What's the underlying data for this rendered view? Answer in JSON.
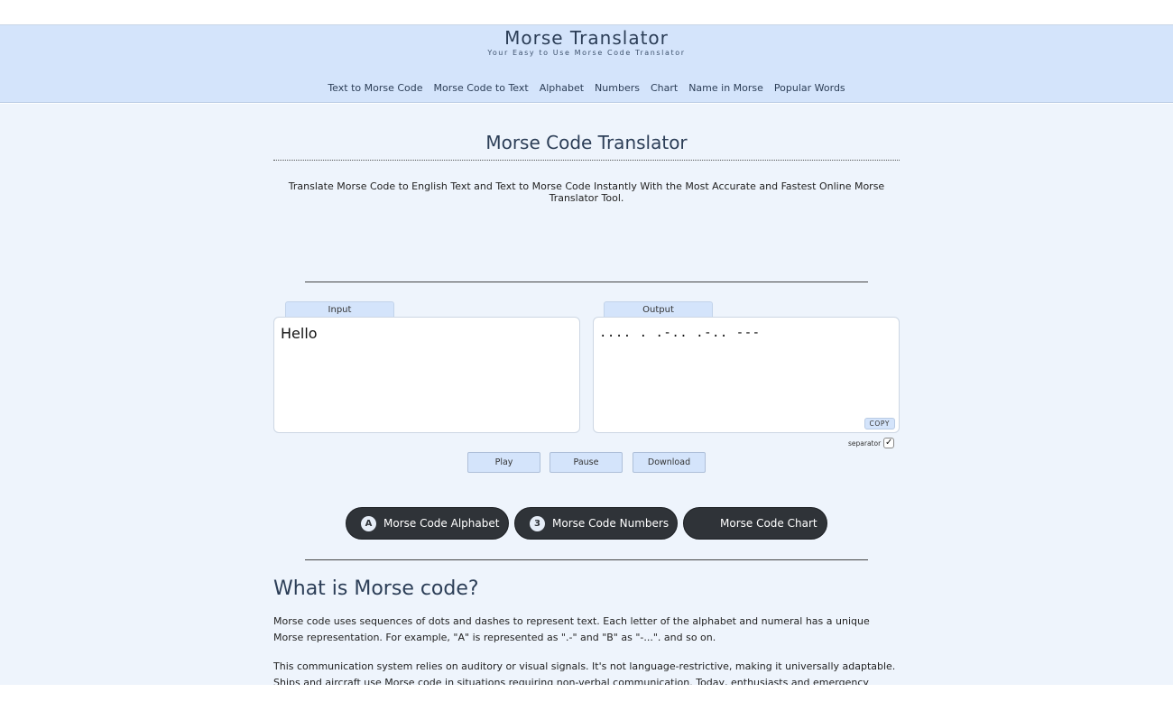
{
  "header": {
    "title": "Morse Translator",
    "subtitle": "Your Easy to Use Morse Code Translator",
    "nav": [
      "Text to Morse Code",
      "Morse Code to Text",
      "Alphabet",
      "Numbers",
      "Chart",
      "Name in Morse",
      "Popular Words"
    ]
  },
  "main": {
    "heading": "Morse Code Translator",
    "intro": "Translate Morse Code to English Text and Text to Morse Code Instantly With the Most Accurate and Fastest Online Morse Translator Tool.",
    "input_tab": "Input",
    "input_value": "Hello",
    "output_tab": "Output",
    "output_value": ".... . .-.. .-.. ---",
    "copy_label": "COPY",
    "separator_label": "separator",
    "separator_checked": true,
    "controls": [
      "Play",
      "Pause",
      "Download"
    ],
    "links": [
      {
        "badge": "A",
        "label": "Morse Code Alphabet"
      },
      {
        "badge": "3",
        "label": "Morse Code Numbers"
      },
      {
        "badge": "",
        "label": "Morse Code Chart"
      }
    ],
    "section_title": "What is Morse code?",
    "paragraphs": [
      "Morse code uses sequences of dots and dashes to represent text. Each letter of the alphabet and numeral has a unique Morse representation. For example, \"A\" is represented as \".-\" and \"B\" as \"-...\". and so on.",
      "This communication system relies on auditory or visual signals. It's not language-restrictive, making it universally adaptable. Ships and aircraft use Morse code in situations requiring non-verbal communication. Today, enthusiasts and emergency services also find Morse to"
    ]
  },
  "colors": {
    "header_bg": "#d4e4fb",
    "page_bg": "#eef4fc",
    "pill_bg": "#2f3338",
    "heading_text": "#2c3e57"
  }
}
